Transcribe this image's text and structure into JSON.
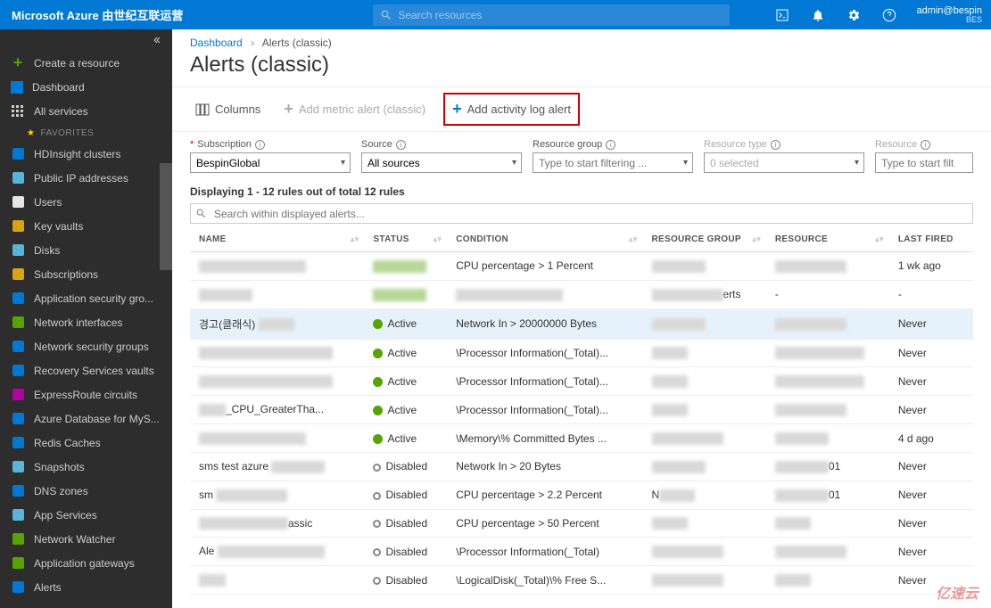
{
  "header": {
    "brand": "Microsoft Azure 由世纪互联运营",
    "search_placeholder": "Search resources",
    "user_email": "admin@bespin",
    "user_tenant": "BES"
  },
  "sidebar": {
    "create": "Create a resource",
    "dashboard": "Dashboard",
    "all_services": "All services",
    "favorites_label": "FAVORITES",
    "items": [
      {
        "icon": "hdinsight",
        "label": "HDInsight clusters",
        "color": "#0078d4"
      },
      {
        "icon": "ip",
        "label": "Public IP addresses",
        "color": "#59b4d9"
      },
      {
        "icon": "users",
        "label": "Users",
        "color": "#e6e6e6"
      },
      {
        "icon": "key",
        "label": "Key vaults",
        "color": "#dba213"
      },
      {
        "icon": "disks",
        "label": "Disks",
        "color": "#59b4d9"
      },
      {
        "icon": "subs",
        "label": "Subscriptions",
        "color": "#dba213"
      },
      {
        "icon": "asg",
        "label": "Application security gro...",
        "color": "#0078d4"
      },
      {
        "icon": "nic",
        "label": "Network interfaces",
        "color": "#57a300"
      },
      {
        "icon": "nsg",
        "label": "Network security groups",
        "color": "#0078d4"
      },
      {
        "icon": "rsv",
        "label": "Recovery Services vaults",
        "color": "#0078d4"
      },
      {
        "icon": "er",
        "label": "ExpressRoute circuits",
        "color": "#b4009e"
      },
      {
        "icon": "mysql",
        "label": "Azure Database for MyS...",
        "color": "#0078d4"
      },
      {
        "icon": "redis",
        "label": "Redis Caches",
        "color": "#0078d4"
      },
      {
        "icon": "snap",
        "label": "Snapshots",
        "color": "#59b4d9"
      },
      {
        "icon": "dns",
        "label": "DNS zones",
        "color": "#0078d4"
      },
      {
        "icon": "app",
        "label": "App Services",
        "color": "#59b4d9"
      },
      {
        "icon": "nw",
        "label": "Network Watcher",
        "color": "#57a300"
      },
      {
        "icon": "agw",
        "label": "Application gateways",
        "color": "#57a300"
      },
      {
        "icon": "alerts",
        "label": "Alerts",
        "color": "#0078d4"
      }
    ]
  },
  "breadcrumb": {
    "root": "Dashboard",
    "current": "Alerts (classic)"
  },
  "page": {
    "title": "Alerts (classic)"
  },
  "toolbar": {
    "columns": "Columns",
    "add_metric": "Add metric alert (classic)",
    "add_activity": "Add activity log alert"
  },
  "filters": {
    "subscription": {
      "label": "Subscription",
      "value": "BespinGlobal"
    },
    "source": {
      "label": "Source",
      "value": "All sources"
    },
    "resource_group": {
      "label": "Resource group",
      "placeholder": "Type to start filtering ..."
    },
    "resource_type": {
      "label": "Resource type",
      "value": "0 selected"
    },
    "resource": {
      "label": "Resource",
      "placeholder": "Type to start filtering ..."
    }
  },
  "display_info": "Displaying 1 - 12 rules out of total 12 rules",
  "table_search_placeholder": "Search within displayed alerts...",
  "columns": {
    "name": "NAME",
    "status": "STATUS",
    "condition": "CONDITION",
    "resource_group": "RESOURCE GROUP",
    "resource": "RESOURCE",
    "last_fired": "LAST FIRED"
  },
  "rows": [
    {
      "name_redact": "r120",
      "status": "",
      "status_redact": "r60",
      "condition": "CPU percentage > 1 Percent",
      "rg_redact": "r60",
      "res_redact": "r80",
      "last": "1 wk ago"
    },
    {
      "name_redact": "r60",
      "status": "",
      "status_redact": "r60",
      "condition_redact": "r120",
      "rg_text_suffix": "erts",
      "rg_redact": "r80",
      "res": "-",
      "last": "-"
    },
    {
      "selected": true,
      "name_prefix": "경고(클래식)",
      "name_redact": "r40",
      "status": "Active",
      "condition": "Network In > 20000000 Bytes",
      "rg_redact": "r60",
      "res_redact": "r80",
      "last": "Never"
    },
    {
      "name_redact": "r150",
      "status": "Active",
      "condition": "\\Processor Information(_Total)...",
      "rg_redact": "r40",
      "res_redact": "r100",
      "last": "Never"
    },
    {
      "name_redact": "r150",
      "status": "Active",
      "condition": "\\Processor Information(_Total)...",
      "rg_redact": "r40",
      "res_redact": "r100",
      "last": "Never"
    },
    {
      "name_prefix": "",
      "name_suffix": "_CPU_GreaterTha...",
      "name_redact": "r30",
      "status": "Active",
      "condition": "\\Processor Information(_Total)...",
      "rg_redact": "r40",
      "res_redact": "r80",
      "last": "Never"
    },
    {
      "name_redact": "r120",
      "status": "Active",
      "condition": "\\Memory\\% Committed Bytes ...",
      "rg_redact": "r80",
      "res_redact": "r60",
      "last": "4 d ago"
    },
    {
      "name_prefix": "sms test azure",
      "name_redact": "r60",
      "status": "Disabled",
      "condition": "Network In > 20 Bytes",
      "rg_redact": "r60",
      "res_suffix": "01",
      "res_redact": "r60",
      "last": "Never"
    },
    {
      "name_prefix": "sm",
      "name_redact": "r80",
      "status": "Disabled",
      "condition": "CPU percentage > 2.2 Percent",
      "rg_prefix": "N",
      "rg_redact": "r40",
      "res_suffix": "01",
      "res_redact": "r60",
      "last": "Never"
    },
    {
      "name_suffix": "assic",
      "name_redact": "r100",
      "status": "Disabled",
      "condition": "CPU percentage > 50 Percent",
      "rg_redact": "r40",
      "res_redact": "r40",
      "last": "Never"
    },
    {
      "name_prefix": "Ale",
      "name_redact": "r120",
      "status": "Disabled",
      "condition": "\\Processor Information(_Total)",
      "rg_redact": "r80",
      "res_redact": "r80",
      "last": "Never"
    },
    {
      "name_redact": "r30",
      "status": "Disabled",
      "condition": "\\LogicalDisk(_Total)\\% Free S...",
      "rg_redact": "r80",
      "res_redact": "r40",
      "last": "Never"
    }
  ],
  "watermark": "亿速云"
}
